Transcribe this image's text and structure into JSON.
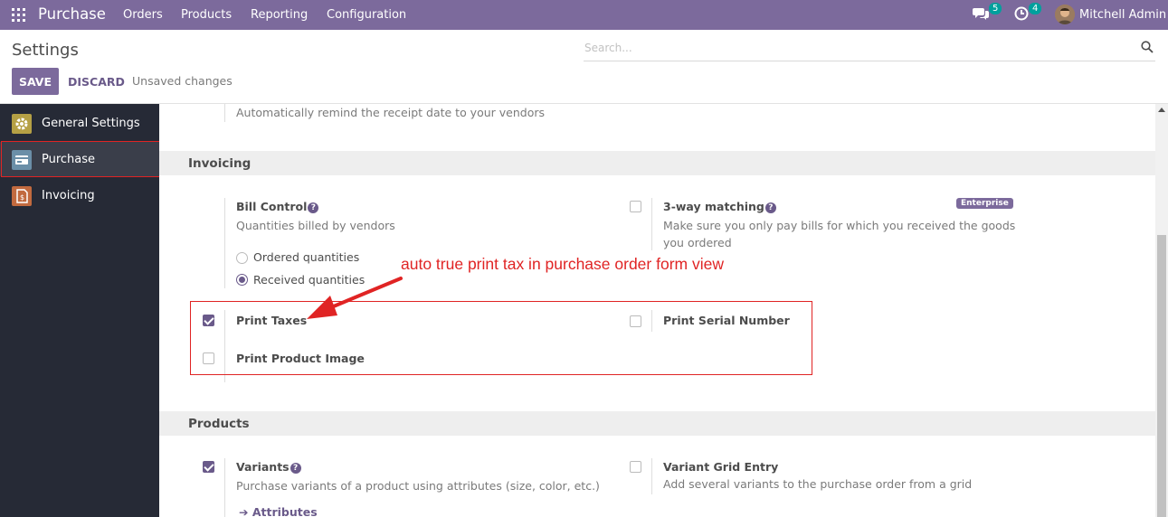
{
  "navbar": {
    "brand": "Purchase",
    "menu": [
      "Orders",
      "Products",
      "Reporting",
      "Configuration"
    ],
    "messages_count": "5",
    "activities_count": "4",
    "user": "Mitchell Admin"
  },
  "control_panel": {
    "title": "Settings",
    "search_placeholder": "Search...",
    "save_label": "SAVE",
    "discard_label": "DISCARD",
    "status": "Unsaved changes"
  },
  "sidebar": {
    "items": [
      {
        "label": "General Settings",
        "icon": "gear-icon",
        "color": "#b5a045",
        "active": false
      },
      {
        "label": "Purchase",
        "icon": "card-icon",
        "color": "#6b8fa8",
        "active": true
      },
      {
        "label": "Invoicing",
        "icon": "invoice-icon",
        "color": "#c26a3f",
        "active": false
      }
    ]
  },
  "content": {
    "top_desc": "Automatically remind the receipt date to your vendors",
    "invoicing": {
      "title": "Invoicing",
      "bill_control": {
        "title": "Bill Control",
        "desc": "Quantities billed by vendors",
        "options": [
          {
            "label": "Ordered quantities",
            "selected": false
          },
          {
            "label": "Received quantities",
            "selected": true
          }
        ]
      },
      "three_way": {
        "title": "3-way matching",
        "badge": "Enterprise",
        "desc": "Make sure you only pay bills for which you received the goods you ordered",
        "checked": false
      },
      "print_taxes": {
        "title": "Print Taxes",
        "checked": true
      },
      "print_serial": {
        "title": "Print Serial Number",
        "checked": false
      },
      "print_image": {
        "title": "Print Product Image",
        "checked": false
      }
    },
    "products": {
      "title": "Products",
      "variants": {
        "title": "Variants",
        "desc": "Purchase variants of a product using attributes (size, color, etc.)",
        "link": "Attributes",
        "checked": true
      },
      "variant_grid": {
        "title": "Variant Grid Entry",
        "desc": "Add several variants to the purchase order from a grid",
        "checked": false
      }
    }
  },
  "annotation": "auto true print tax in purchase order form view",
  "colors": {
    "accent": "#7c6a9c",
    "highlight": "#e02424"
  }
}
